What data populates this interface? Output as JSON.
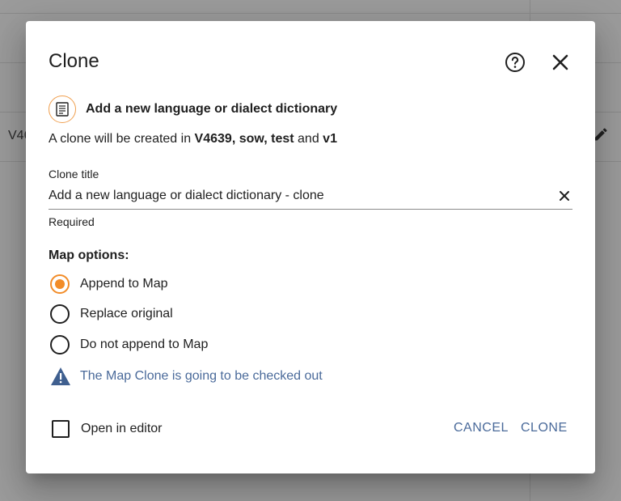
{
  "background": {
    "row_text": "V46"
  },
  "dialog": {
    "title": "Clone",
    "help_icon": "help-circle-icon",
    "close_icon": "close-icon",
    "item": {
      "icon": "document-list-icon",
      "name": "Add a new language or dialect dictionary"
    },
    "info": {
      "prefix": "A clone will be created in ",
      "location": "V4639, sow, test",
      "joiner": " and ",
      "version": "v1"
    },
    "field": {
      "label": "Clone title",
      "value": "Add a new language or dialect dictionary - clone",
      "hint": "Required"
    },
    "map_options": {
      "title": "Map options:",
      "options": [
        {
          "label": "Append to Map",
          "checked": true
        },
        {
          "label": "Replace original",
          "checked": false
        },
        {
          "label": "Do not append to Map",
          "checked": false
        }
      ]
    },
    "warning": {
      "icon": "warning-triangle-icon",
      "text": "The Map Clone is going to be checked out"
    },
    "open_in_editor": {
      "label": "Open in editor",
      "checked": false
    },
    "buttons": {
      "cancel": "CANCEL",
      "clone": "CLONE"
    }
  },
  "colors": {
    "accent": "#f28c28",
    "link": "#4a6a9a",
    "text": "#1f1f1f"
  }
}
